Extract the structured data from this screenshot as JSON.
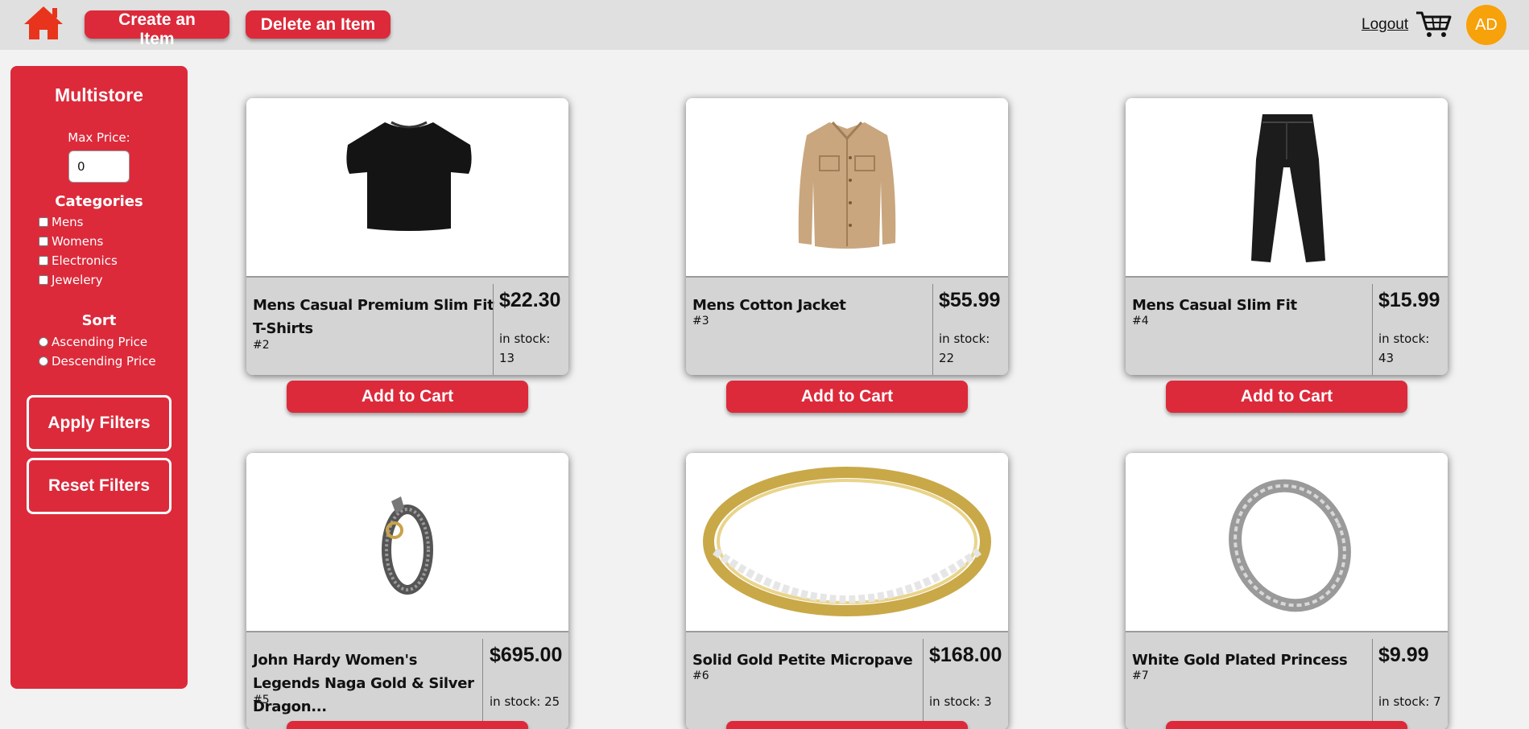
{
  "header": {
    "create_label": "Create an Item",
    "delete_label": "Delete an Item",
    "logout_label": "Logout",
    "avatar_initials": "AD",
    "accent": "#dc2a3b",
    "avatar_color": "#f7a10b"
  },
  "sidebar": {
    "title": "Multistore",
    "max_price_label": "Max Price:",
    "max_price_value": "0",
    "categories_title": "Categories",
    "categories": [
      "Mens",
      "Womens",
      "Electronics",
      "Jewelery"
    ],
    "sort_title": "Sort",
    "sort_options": [
      "Ascending Price",
      "Descending Price"
    ],
    "apply_label": "Apply Filters",
    "reset_label": "Reset Filters"
  },
  "products": [
    {
      "name": "Mens Casual Premium Slim Fit T-Shirts",
      "id": "#2",
      "price": "$22.30",
      "stock": "in stock: 13",
      "image": "black-tshirt"
    },
    {
      "name": "Mens Cotton Jacket",
      "id": "#3",
      "price": "$55.99",
      "stock": "in stock: 22",
      "image": "tan-jacket"
    },
    {
      "name": "Mens Casual Slim Fit",
      "id": "#4",
      "price": "$15.99",
      "stock": "in stock: 43",
      "image": "black-pants"
    },
    {
      "name": "John Hardy Women's Legends Naga Gold & Silver Dragon...",
      "id": "#5",
      "price": "$695.00",
      "stock": "in stock: 25",
      "image": "dragon-bracelet"
    },
    {
      "name": "Solid Gold Petite Micropave",
      "id": "#6",
      "price": "$168.00",
      "stock": "in stock: 3",
      "image": "gold-ring"
    },
    {
      "name": "White Gold Plated Princess",
      "id": "#7",
      "price": "$9.99",
      "stock": "in stock: 7",
      "image": "silver-ring"
    }
  ],
  "add_to_cart_label": "Add to Cart"
}
